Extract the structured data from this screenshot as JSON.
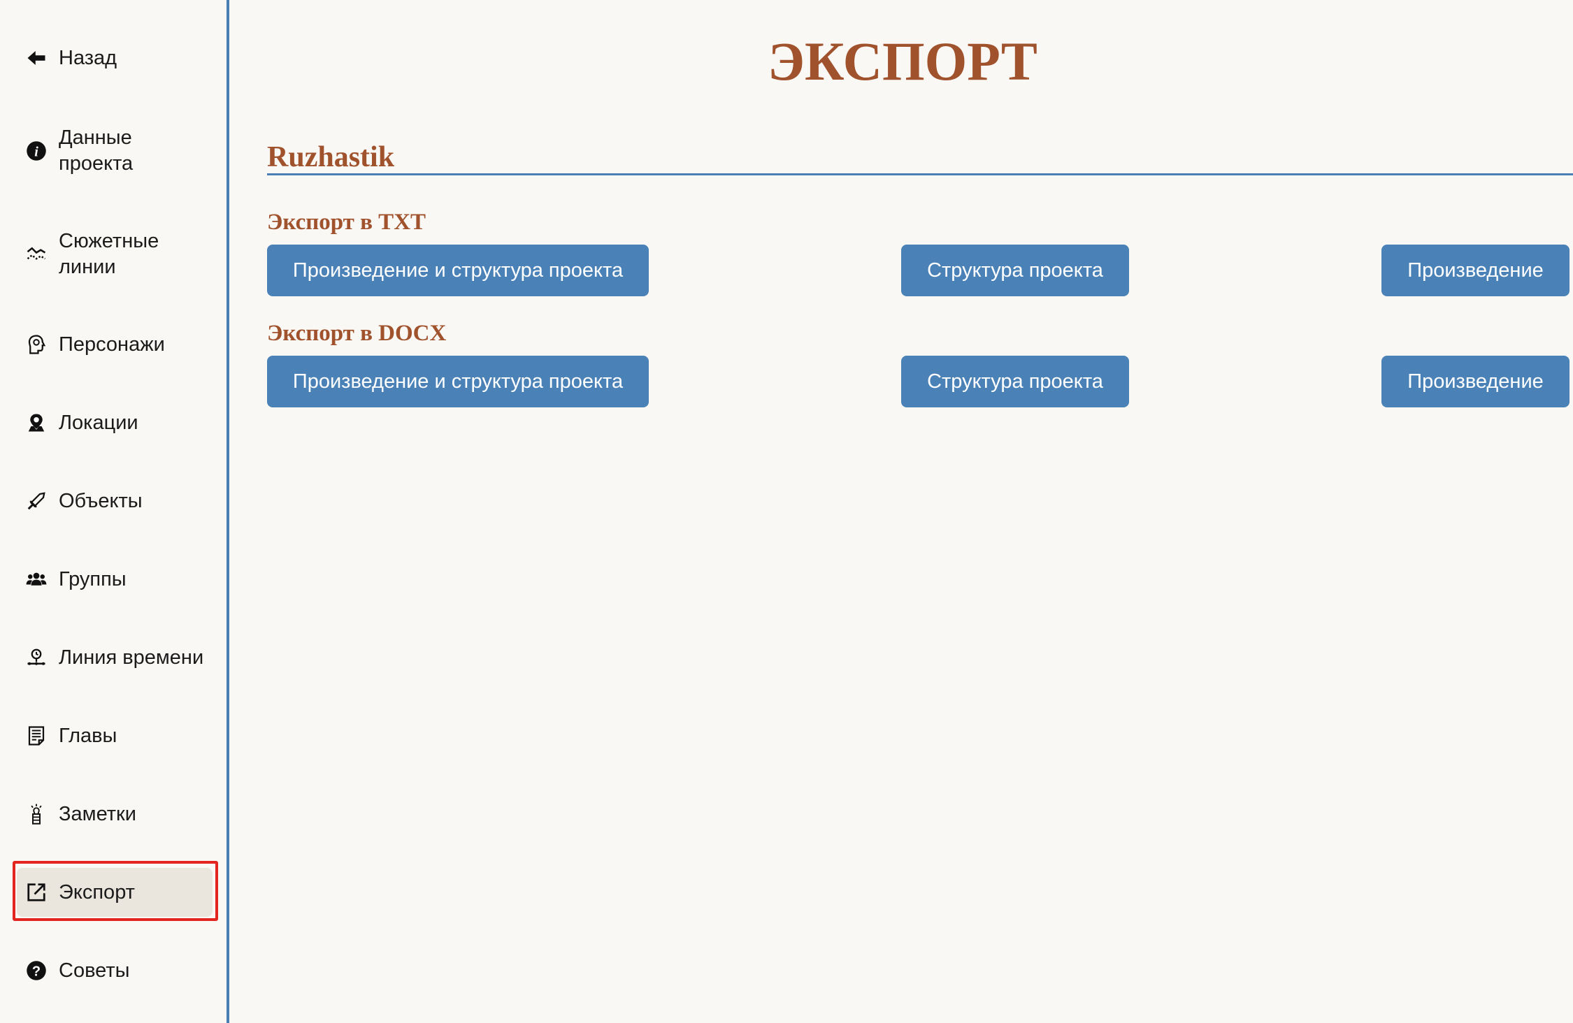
{
  "sidebar": {
    "items": [
      {
        "label": "Назад",
        "icon": "arrow-left-icon"
      },
      {
        "label": "Данные проекта",
        "icon": "info-icon"
      },
      {
        "label": "Сюжетные линии",
        "icon": "plotlines-icon"
      },
      {
        "label": "Персонажи",
        "icon": "character-head-icon"
      },
      {
        "label": "Локации",
        "icon": "location-pin-icon"
      },
      {
        "label": "Объекты",
        "icon": "sword-icon"
      },
      {
        "label": "Группы",
        "icon": "group-users-icon"
      },
      {
        "label": "Линия времени",
        "icon": "timeline-icon"
      },
      {
        "label": "Главы",
        "icon": "chapters-document-icon"
      },
      {
        "label": "Заметки",
        "icon": "notes-lightbulb-icon"
      },
      {
        "label": "Экспорт",
        "icon": "export-icon",
        "active": true
      },
      {
        "label": "Советы",
        "icon": "question-circle-icon"
      }
    ]
  },
  "main": {
    "title": "ЭКСПОРТ",
    "project_name": "Ruzhastik",
    "sections": [
      {
        "title": "Экспорт в TXT",
        "buttons": [
          "Произведение и структура проекта",
          "Структура проекта",
          "Произведение"
        ]
      },
      {
        "title": "Экспорт в DOCX",
        "buttons": [
          "Произведение и структура проекта",
          "Структура проекта",
          "Произведение"
        ]
      }
    ]
  },
  "colors": {
    "accent_blue": "#4a82b8",
    "title_brown": "#a0522d",
    "background": "#faf8f4",
    "active_bg": "#ebe6dd",
    "highlight_red": "#e3251f"
  }
}
